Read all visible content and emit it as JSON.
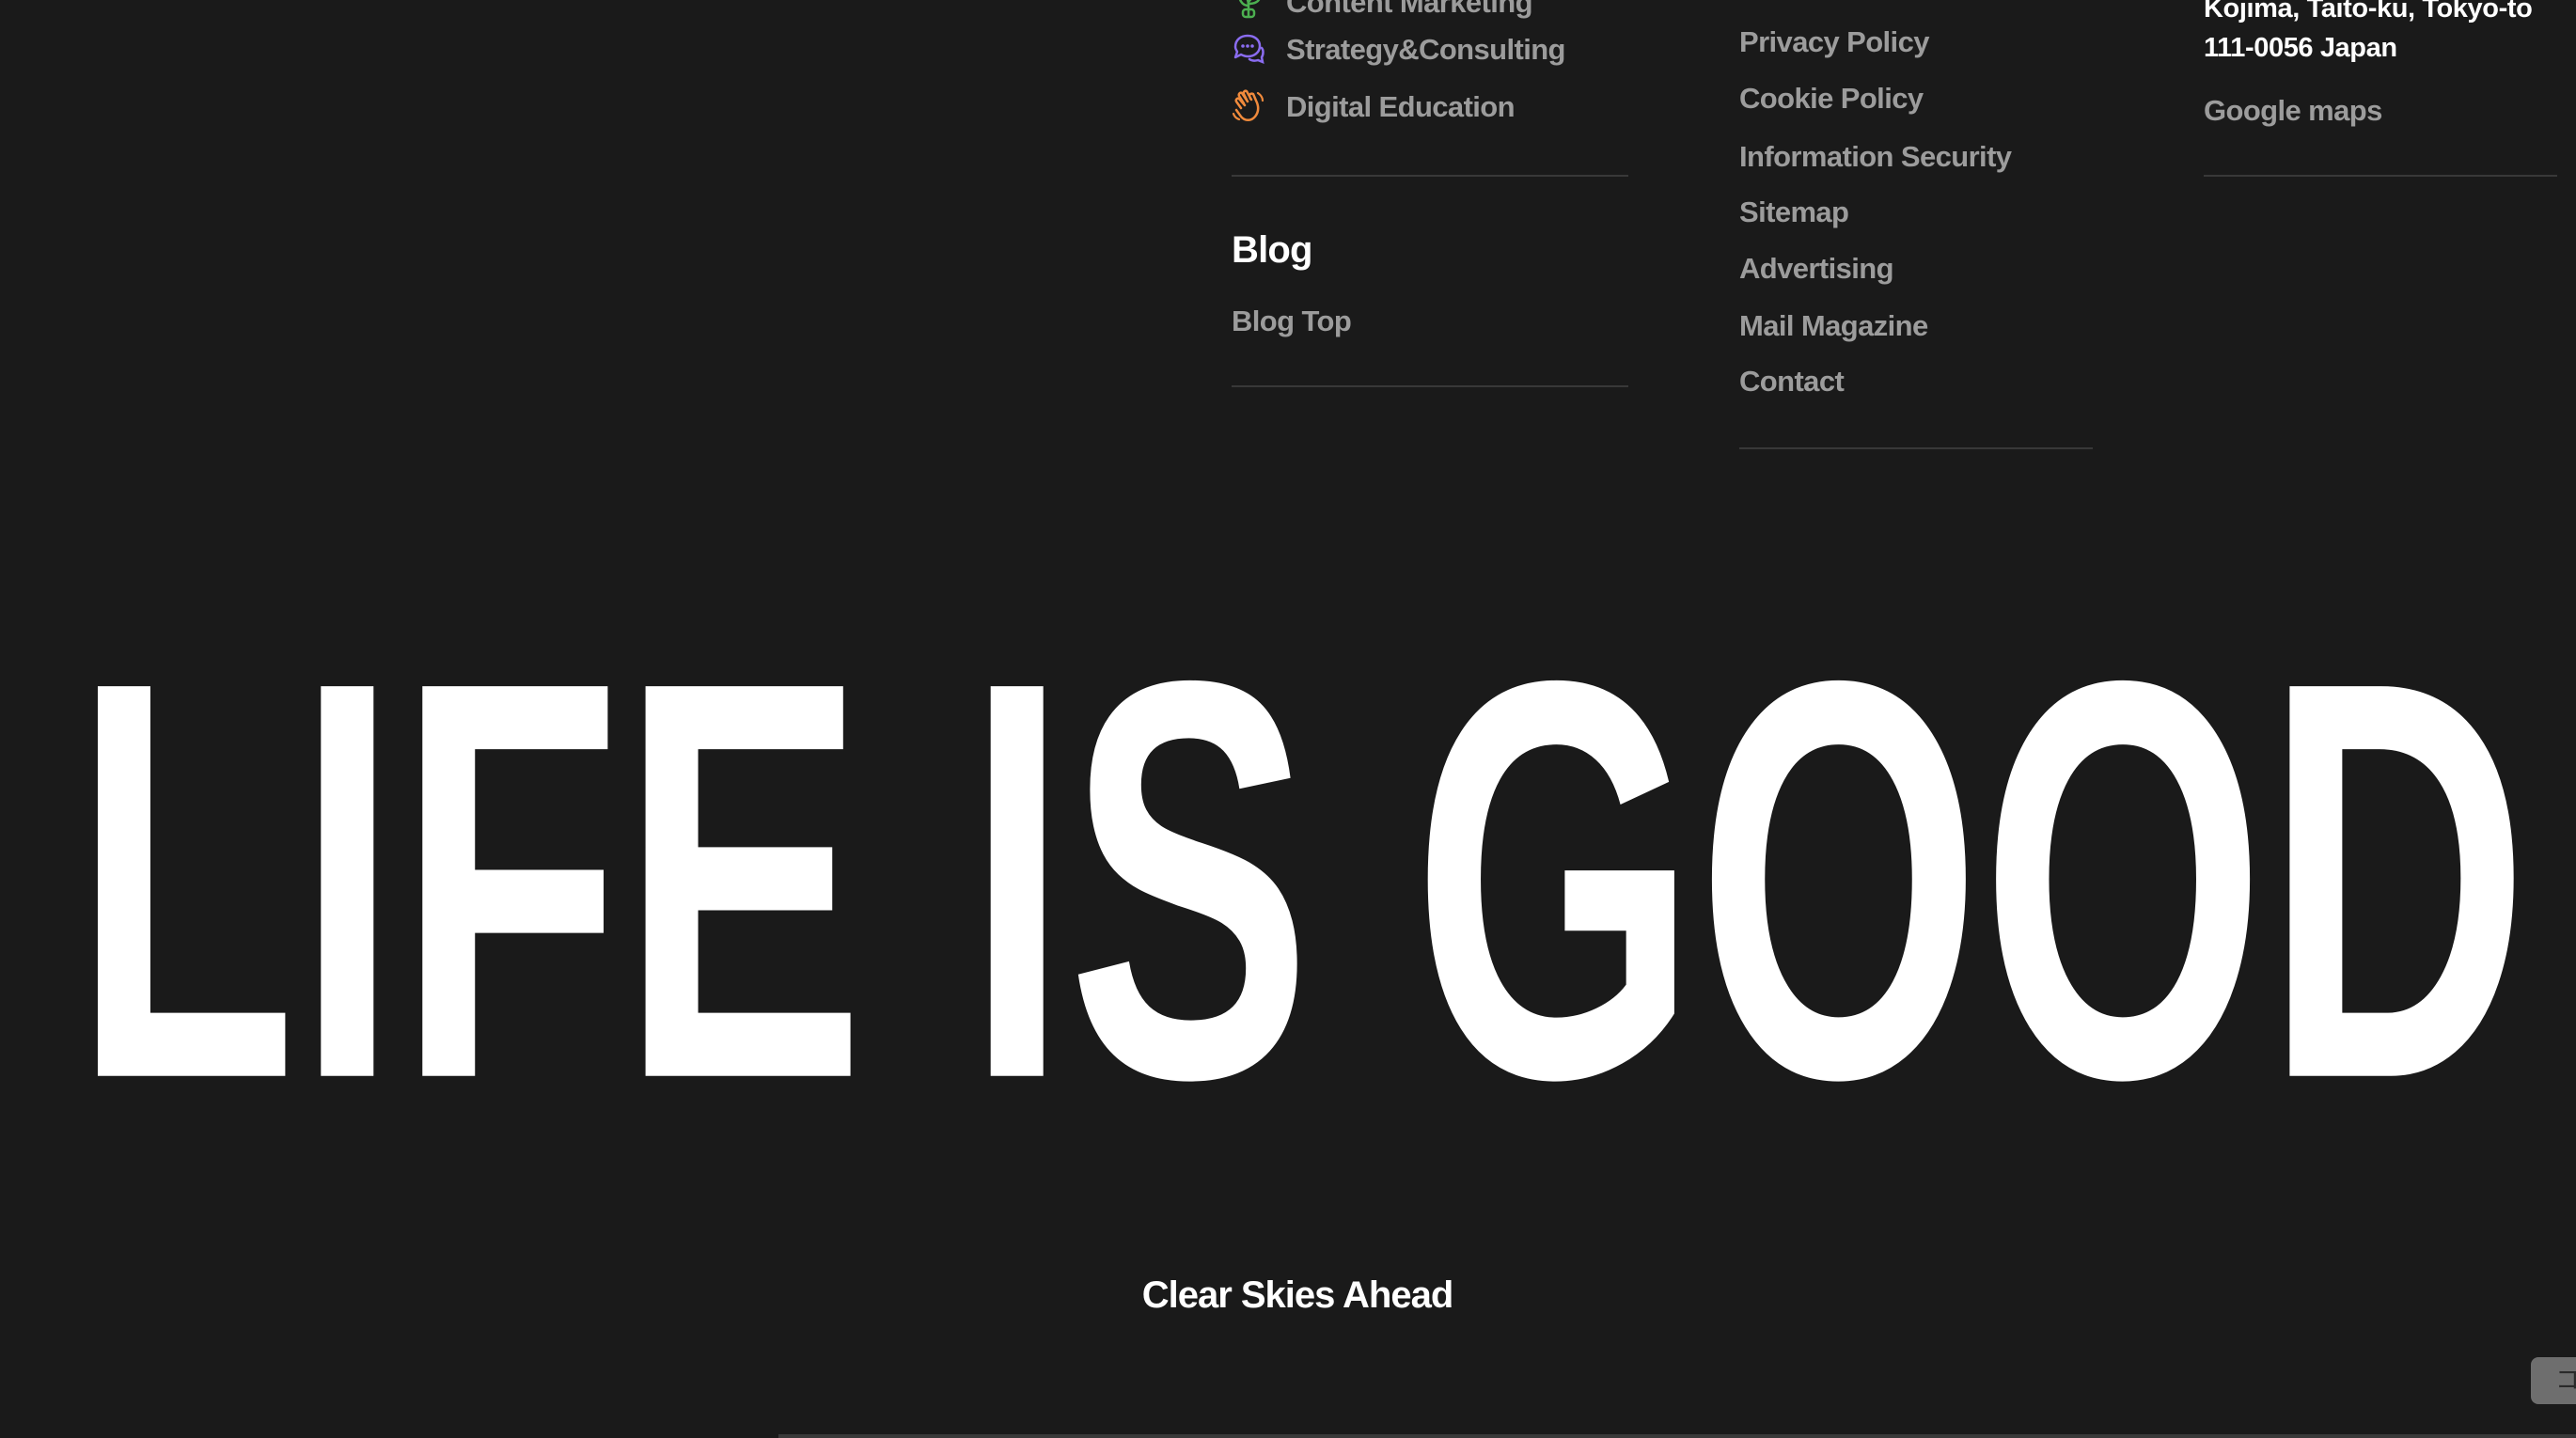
{
  "services": {
    "items": [
      {
        "label": "Content Marketing",
        "icon": "plant-icon",
        "color": "#4caf50"
      },
      {
        "label": "Strategy&Consulting",
        "icon": "chat-bubbles-icon",
        "color": "#8a6cf0"
      },
      {
        "label": "Digital Education",
        "icon": "waving-hand-icon",
        "color": "#f08a3c"
      }
    ]
  },
  "blog": {
    "heading": "Blog",
    "link": "Blog Top"
  },
  "legal": {
    "links": [
      "Privacy Policy",
      "Cookie Policy",
      "Information Security",
      "Sitemap",
      "Advertising",
      "Mail Magazine",
      "Contact"
    ]
  },
  "address": {
    "line1": "Kojima, Taito-ku, Tokyo-to",
    "line2": "111-0056 Japan",
    "map_link": "Google maps"
  },
  "hero": {
    "text": "LIFE IS GOOD"
  },
  "tagline": "Clear Skies Ahead",
  "side_tab": {
    "label": "コ"
  },
  "colors": {
    "background": "#1a1a1a",
    "link": "#9c9c9c",
    "heading": "#ffffff"
  }
}
